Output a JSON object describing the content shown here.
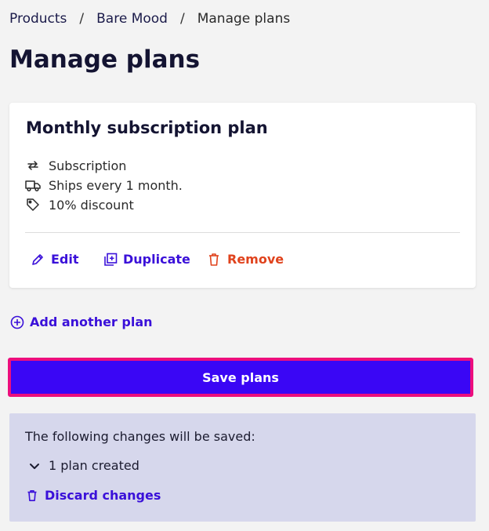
{
  "breadcrumb": {
    "items": [
      "Products",
      "Bare Mood"
    ],
    "separator": "/",
    "current": "Manage plans"
  },
  "page": {
    "title": "Manage plans"
  },
  "plan_card": {
    "title": "Monthly subscription plan",
    "details": [
      {
        "icon": "repeat-icon",
        "text": "Subscription"
      },
      {
        "icon": "truck-icon",
        "text": "Ships every 1 month."
      },
      {
        "icon": "tag-icon",
        "text": "10% discount"
      }
    ],
    "actions": {
      "edit": "Edit",
      "duplicate": "Duplicate",
      "remove": "Remove"
    }
  },
  "add_plan_label": "Add another plan",
  "save_button_label": "Save plans",
  "changes": {
    "heading": "The following changes will be saved:",
    "items": [
      "1 plan created"
    ],
    "discard_label": "Discard changes"
  },
  "colors": {
    "accent": "#3a10d9",
    "save_button": "#3a06f5",
    "focus_ring": "#ec0e7d",
    "danger": "#e0431d",
    "changes_panel": "#d6d7ec"
  }
}
